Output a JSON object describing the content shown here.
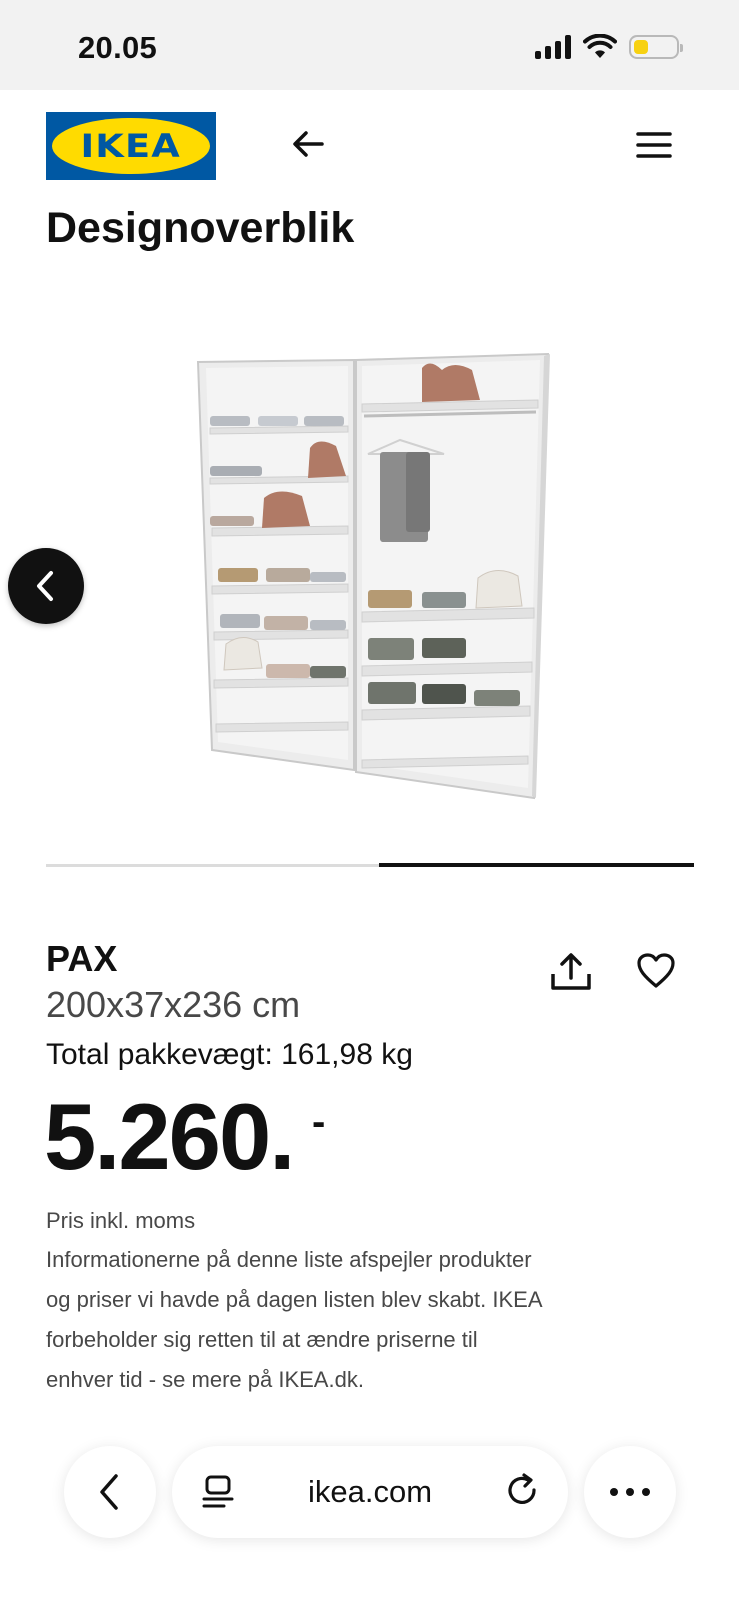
{
  "status_bar": {
    "time": "20.05"
  },
  "header": {
    "logo_text": "IKEA",
    "brand_colors": {
      "blue": "#0058a3",
      "yellow": "#ffdb00"
    },
    "back_icon": "arrow-left-icon",
    "menu_icon": "hamburger-menu-icon"
  },
  "page": {
    "title": "Designoverblik"
  },
  "carousel": {
    "prev_icon": "chevron-left-icon",
    "position": 0.5
  },
  "product": {
    "name": "PAX",
    "dimensions": "200x37x236 cm",
    "weight_label": "Total pakkevægt: 161,98 kg",
    "price": "5.260.",
    "price_suffix": "-",
    "vat_note": "Pris inkl. moms",
    "info": "Informationerne på denne liste afspejler produkter og priser vi havde på dagen listen blev skabt. IKEA forbeholder sig retten til at ændre priserne til enhver tid - se mere på IKEA.dk.",
    "share_icon": "share-icon",
    "favorite_icon": "heart-icon"
  },
  "browser": {
    "url": "ikea.com",
    "back_icon": "chevron-left-icon",
    "tabs_icon": "tabs-icon",
    "reload_icon": "reload-icon",
    "more_icon": "more-dots-icon"
  }
}
